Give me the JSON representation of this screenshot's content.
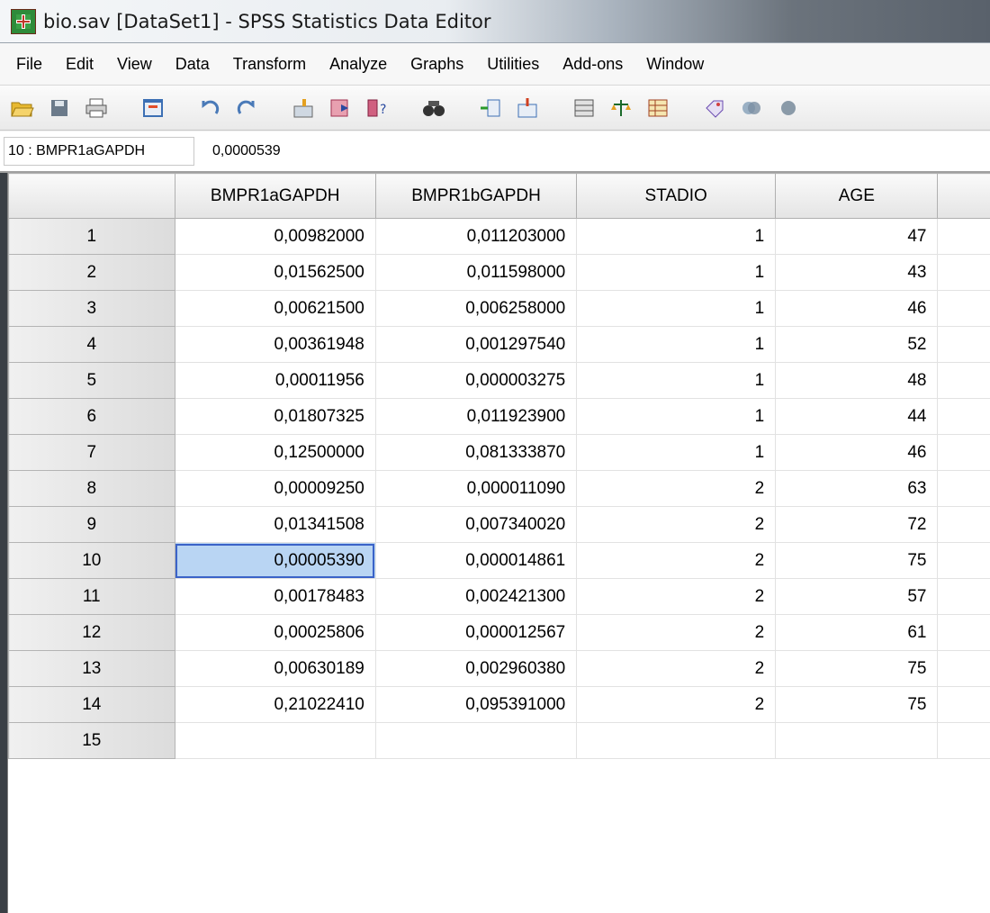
{
  "window": {
    "title": "bio.sav [DataSet1] - SPSS Statistics Data Editor"
  },
  "menu": [
    "File",
    "Edit",
    "View",
    "Data",
    "Transform",
    "Analyze",
    "Graphs",
    "Utilities",
    "Add-ons",
    "Window"
  ],
  "toolbar_icons": [
    "open-icon",
    "save-icon",
    "print-icon",
    "dialog-recall-icon",
    "undo-icon",
    "redo-icon",
    "goto-case-icon",
    "goto-variable-icon",
    "variables-icon",
    "find-icon",
    "insert-cases-icon",
    "insert-variable-icon",
    "split-file-icon",
    "weight-cases-icon",
    "select-cases-icon",
    "value-labels-icon",
    "use-sets-icon",
    "show-all-icon"
  ],
  "refbar": {
    "cell_name": "10 : BMPR1aGAPDH",
    "cell_value": "0,0000539"
  },
  "grid": {
    "columns": [
      "BMPR1aGAPDH",
      "BMPR1bGAPDH",
      "STADIO",
      "AGE",
      ""
    ],
    "rows": [
      {
        "n": "1",
        "cells": [
          "0,00982000",
          "0,011203000",
          "1",
          "47",
          ""
        ]
      },
      {
        "n": "2",
        "cells": [
          "0,01562500",
          "0,011598000",
          "1",
          "43",
          ""
        ]
      },
      {
        "n": "3",
        "cells": [
          "0,00621500",
          "0,006258000",
          "1",
          "46",
          ""
        ]
      },
      {
        "n": "4",
        "cells": [
          "0,00361948",
          "0,001297540",
          "1",
          "52",
          ""
        ]
      },
      {
        "n": "5",
        "cells": [
          "0,00011956",
          "0,000003275",
          "1",
          "48",
          ""
        ]
      },
      {
        "n": "6",
        "cells": [
          "0,01807325",
          "0,011923900",
          "1",
          "44",
          ""
        ]
      },
      {
        "n": "7",
        "cells": [
          "0,12500000",
          "0,081333870",
          "1",
          "46",
          ""
        ]
      },
      {
        "n": "8",
        "cells": [
          "0,00009250",
          "0,000011090",
          "2",
          "63",
          ""
        ]
      },
      {
        "n": "9",
        "cells": [
          "0,01341508",
          "0,007340020",
          "2",
          "72",
          ""
        ]
      },
      {
        "n": "10",
        "cells": [
          "0,00005390",
          "0,000014861",
          "2",
          "75",
          ""
        ]
      },
      {
        "n": "11",
        "cells": [
          "0,00178483",
          "0,002421300",
          "2",
          "57",
          ""
        ]
      },
      {
        "n": "12",
        "cells": [
          "0,00025806",
          "0,000012567",
          "2",
          "61",
          ""
        ]
      },
      {
        "n": "13",
        "cells": [
          "0,00630189",
          "0,002960380",
          "2",
          "75",
          ""
        ]
      },
      {
        "n": "14",
        "cells": [
          "0,21022410",
          "0,095391000",
          "2",
          "75",
          ""
        ]
      },
      {
        "n": "15",
        "cells": [
          "",
          "",
          "",
          "",
          ""
        ]
      }
    ],
    "selected": {
      "row": 9,
      "col": 0
    }
  }
}
